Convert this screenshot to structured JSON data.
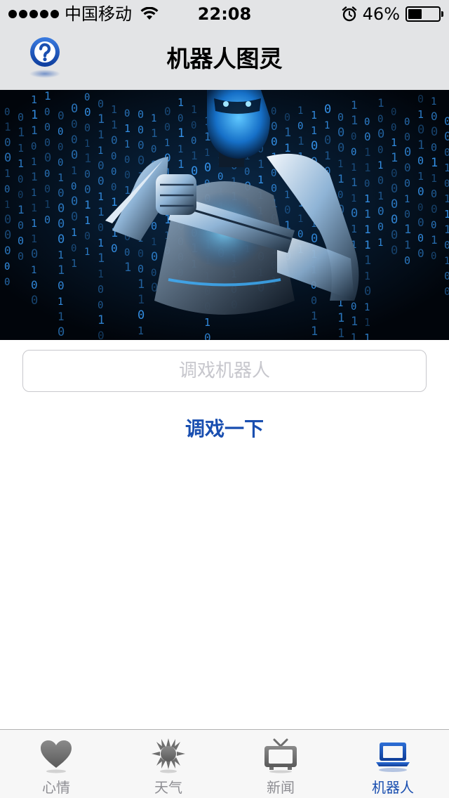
{
  "status_bar": {
    "carrier": "中国移动",
    "time": "22:08",
    "battery_percent_label": "46%",
    "battery_level": 0.46
  },
  "nav": {
    "title": "机器人图灵"
  },
  "chat": {
    "input_placeholder": "调戏机器人",
    "input_value": "",
    "action_label": "调戏一下"
  },
  "tabs": [
    {
      "label": "心情",
      "icon": "heart-icon",
      "active": false
    },
    {
      "label": "天气",
      "icon": "sun-icon",
      "active": false
    },
    {
      "label": "新闻",
      "icon": "tv-icon",
      "active": false
    },
    {
      "label": "机器人",
      "icon": "laptop-icon",
      "active": true
    }
  ],
  "colors": {
    "accent": "#1a4fb0",
    "tab_inactive": "#8e8e93",
    "nav_background": "#e3e4e6"
  }
}
